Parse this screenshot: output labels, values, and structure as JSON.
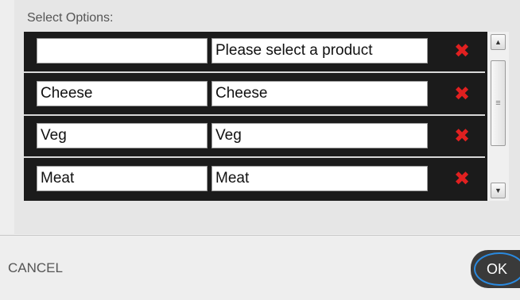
{
  "dialog": {
    "section_label": "Select Options:",
    "cancel_label": "CANCEL",
    "ok_label": "OK"
  },
  "options": [
    {
      "key": "",
      "value": "Please select a product"
    },
    {
      "key": "Cheese",
      "value": "Cheese"
    },
    {
      "key": "Veg",
      "value": "Veg"
    },
    {
      "key": "Meat",
      "value": "Meat"
    }
  ],
  "icons": {
    "delete": "delete-icon",
    "scroll_up": "scroll-up-icon",
    "scroll_down": "scroll-down-icon",
    "grip": "grip-icon"
  },
  "colors": {
    "delete": "#e02020",
    "ok_background": "#3a3a3a",
    "focus_ring": "#2a8ae0",
    "options_background": "#1b1b1b"
  }
}
